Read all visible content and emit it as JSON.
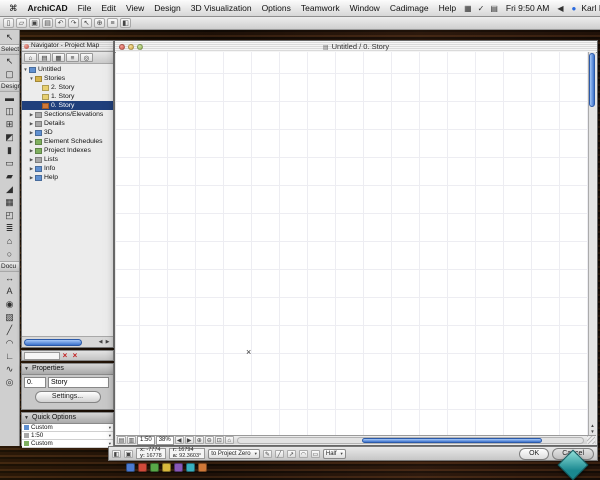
{
  "menubar": {
    "items": [
      "ArchiCAD",
      "File",
      "Edit",
      "View",
      "Design",
      "3D Visualization",
      "Options",
      "Teamwork",
      "Window",
      "Cadimage",
      "Help"
    ],
    "clock": "Fri 9:50 AM",
    "user": "Karl Barker"
  },
  "toolbox": {
    "select_label": "Select",
    "design_label": "Design",
    "docu_label": "Docu"
  },
  "navigator": {
    "title": "Navigator - Project Map",
    "tree": [
      {
        "label": "Untitled"
      },
      {
        "label": "Stories"
      },
      {
        "label": "2. Story"
      },
      {
        "label": "1. Story"
      },
      {
        "label": "0. Story"
      },
      {
        "label": "Sections/Elevations"
      },
      {
        "label": "Details"
      },
      {
        "label": "3D"
      },
      {
        "label": "Element Schedules"
      },
      {
        "label": "Project Indexes"
      },
      {
        "label": "Lists"
      },
      {
        "label": "Info"
      },
      {
        "label": "Help"
      }
    ]
  },
  "properties": {
    "title": "Properties",
    "story_number": "0.",
    "story_name": "Story",
    "settings_button": "Settings..."
  },
  "quick_options": {
    "title": "Quick Options",
    "rows": [
      "Custom",
      "1:50",
      "Custom"
    ]
  },
  "window": {
    "title": "Untitled / 0. Story",
    "scale": "1:50",
    "zoom": "38%"
  },
  "coordbar": {
    "x_label": "x:",
    "x_value": "-7774",
    "y_label": "y:",
    "y_value": "16778",
    "r_label": "r:",
    "r_value": "16794",
    "a_label": "a:",
    "a_value": "92.3603°",
    "origin_select": "to Project Zero",
    "pen_select": "Half",
    "ok": "OK",
    "cancel": "Cancel"
  },
  "colors": {
    "selection": "#20407c",
    "scroll_thumb": "#3c72cc",
    "close_red": "#c22020",
    "desktop_logo": "#1a8890"
  },
  "icons": {
    "apple": "⌘",
    "menu-extra-1": "▦",
    "menu-extra-2": "✓",
    "displays": "▤",
    "volume": "◀",
    "user-badge": "●",
    "spotlight": "◎",
    "tb-new": "▯",
    "tb-open": "▱",
    "tb-save": "▣",
    "tb-print": "▤",
    "tb-undo": "↶",
    "tb-redo": "↷",
    "tb-pointer": "↖",
    "tb-zoom": "⊕",
    "tb-options": "≡",
    "tb-panel": "◧",
    "arrow": "↖",
    "marquee": "▢",
    "wall": "▬",
    "door": "◫",
    "window": "⊞",
    "skylight": "◩",
    "column": "▮",
    "beam": "▭",
    "slab": "▰",
    "roof": "◢",
    "mesh": "▦",
    "zone": "◰",
    "stair": "≣",
    "object": "⌂",
    "lamp": "○",
    "dimension": "↔",
    "text": "A",
    "label": "◉",
    "fill": "▨",
    "line": "╱",
    "arc": "◠",
    "polyline": "∟",
    "spline": "∿",
    "camera": "◎",
    "nav-project": "⌂",
    "nav-view": "▤",
    "nav-layout": "▦",
    "nav-publisher": "≡",
    "nav-settings": "◎",
    "tri-down": "▼",
    "tri-right": "▶",
    "chev-down": "▾",
    "arrow-left": "◀",
    "arrow-right": "▶",
    "arrow-up": "▲",
    "arrow-dn": "▼",
    "pages": "▤",
    "pages2": "▥",
    "zoom-in": "⊕",
    "zoom-out": "⊖",
    "zoom-fit": "⊡",
    "home": "⌂",
    "cb-icon-1": "◧",
    "cb-icon-2": "▣",
    "pencil": "✎",
    "linetool": "╱",
    "arrowtool": "↗",
    "arctool": "◠",
    "boxtool": "▭",
    "close-x": "×",
    "cursor": "×",
    "doc": "▤"
  }
}
